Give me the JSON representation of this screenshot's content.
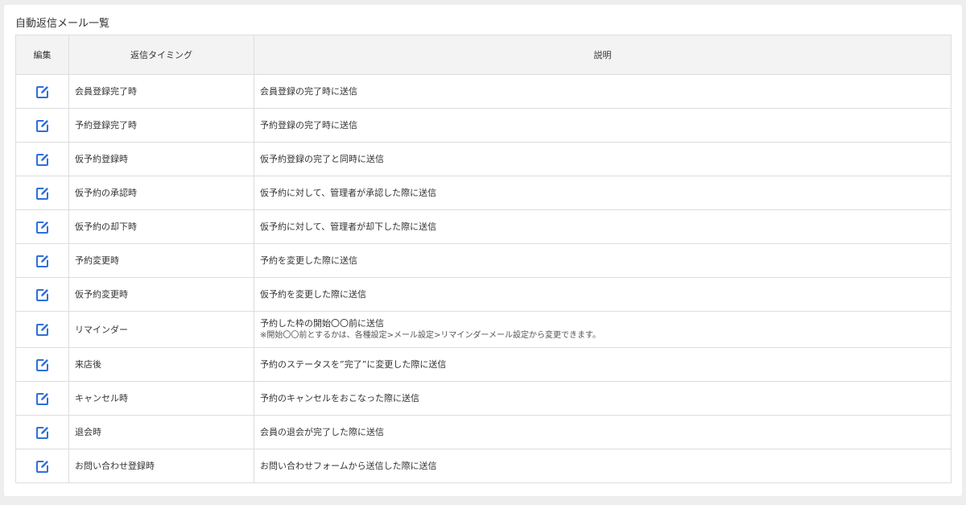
{
  "panel": {
    "title": "自動返信メール一覧"
  },
  "table": {
    "headers": {
      "edit": "編集",
      "timing": "返信タイミング",
      "description": "説明"
    },
    "rows": [
      {
        "timing": "会員登録完了時",
        "description": "会員登録の完了時に送信",
        "note": ""
      },
      {
        "timing": "予約登録完了時",
        "description": "予約登録の完了時に送信",
        "note": ""
      },
      {
        "timing": "仮予約登録時",
        "description": "仮予約登録の完了と同時に送信",
        "note": ""
      },
      {
        "timing": "仮予約の承認時",
        "description": "仮予約に対して、管理者が承認した際に送信",
        "note": ""
      },
      {
        "timing": "仮予約の却下時",
        "description": "仮予約に対して、管理者が却下した際に送信",
        "note": ""
      },
      {
        "timing": "予約変更時",
        "description": "予約を変更した際に送信",
        "note": ""
      },
      {
        "timing": "仮予約変更時",
        "description": "仮予約を変更した際に送信",
        "note": ""
      },
      {
        "timing": "リマインダー",
        "description": "予約した枠の開始〇〇前に送信",
        "note": "※開始〇〇前とするかは、各種設定>メール設定>リマインダーメール設定から変更できます。"
      },
      {
        "timing": "来店後",
        "description": "予約のステータスを”完了”に変更した際に送信",
        "note": ""
      },
      {
        "timing": "キャンセル時",
        "description": "予約のキャンセルをおこなった際に送信",
        "note": ""
      },
      {
        "timing": "退会時",
        "description": "会員の退会が完了した際に送信",
        "note": ""
      },
      {
        "timing": "お問い合わせ登録時",
        "description": "お問い合わせフォームから送信した際に送信",
        "note": ""
      }
    ]
  },
  "icons": {
    "edit": "edit-icon"
  },
  "colors": {
    "icon": "#2f6fdb",
    "border": "#dddddd",
    "header_bg": "#f3f3f3"
  }
}
